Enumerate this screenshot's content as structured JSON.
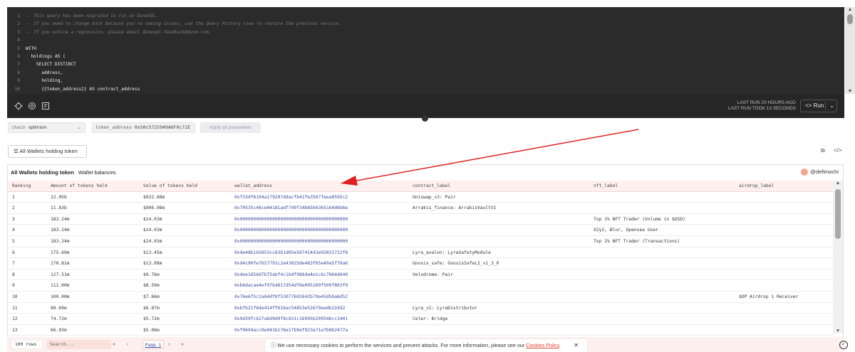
{
  "editor": {
    "lines": [
      {
        "n": "1",
        "text": "-- This query has been migrated to run on DuneSQL.",
        "comment": true
      },
      {
        "n": "2",
        "text": "-- If you need to change back because you're seeing issues, use the Query History view to restore the previous version.",
        "comment": true
      },
      {
        "n": "3",
        "text": "-- If you notice a regression, please email dunesql-feedback@dune.com.",
        "comment": true
      },
      {
        "n": "4",
        "text": "",
        "comment": false
      },
      {
        "n": "5",
        "text": "WITH",
        "comment": false
      },
      {
        "n": "6",
        "text": "  holdings AS (",
        "comment": false
      },
      {
        "n": "7",
        "text": "    SELECT DISTINCT",
        "comment": false
      },
      {
        "n": "8",
        "text": "      address,",
        "comment": false
      },
      {
        "n": "9",
        "text": "      holding,",
        "comment": false
      },
      {
        "n": "10",
        "text": "      {{token_address}} AS contract_address",
        "comment": false
      }
    ]
  },
  "toolbar": {
    "last_run": "LAST RUN 20 HOURS AGO",
    "last_run_took": "LAST RUN TOOK 13 SECONDS",
    "run_label": "Run"
  },
  "params": {
    "chain_label": "chain",
    "chain_value": "optimism",
    "token_label": "token_address",
    "token_value": "0x50c5725949A6F0c72E",
    "apply_label": "Apply all parameters"
  },
  "viz_tab": {
    "label": "All Wallets holding token"
  },
  "results": {
    "title": "All Wallets holding token",
    "subtitle": "Wallet balances",
    "author": "@defimochi",
    "columns": [
      "Ranking",
      "Amount of tokens held",
      "Value of tokens held",
      "wallet_address",
      "contract_label",
      "nft_label",
      "airdrop_label"
    ],
    "rows": [
      [
        "1",
        "12.05b",
        "$922.68m",
        "0xf334f6104a179207ddacfb41fe3567feea8595c2",
        "Uniswap_v3: Pair",
        "",
        ""
      ],
      [
        "2",
        "11.83b",
        "$906.08m",
        "0x70535c46ce04181adf749f34b65b6365164d6b6e",
        "Arrakis_finance: ArrakisVaultV1",
        "",
        ""
      ],
      [
        "3",
        "183.24m",
        "$14.03m",
        "0x0000000000000000000000000000000000000000",
        "",
        "Top 1% NFT Trader (Volume in $USD)",
        ""
      ],
      [
        "4",
        "183.24m",
        "$14.03m",
        "0x0000000000000000000000000000000000000000",
        "",
        "X2y2, Blur, Opensea User",
        ""
      ],
      [
        "5",
        "183.24m",
        "$14.03m",
        "0x0000000000000000000000000000000000000000",
        "",
        "Top 1% NFT Trader (Transactions)",
        ""
      ],
      [
        "6",
        "175.69m",
        "$13.45m",
        "0xde48b1b5853cc63b1d05e507414d3e02831722f8",
        "Lyra_avalon: LyraSafetyModule",
        "",
        ""
      ],
      [
        "7",
        "170.81m",
        "$13.08m",
        "0xd4c00fe7657791c2e43025de483f05e49a5f76a6",
        "Gnosis_safe: GnosisSafeL2_v1_3_0",
        "",
        ""
      ],
      [
        "8",
        "127.51m",
        "$9.76m",
        "0xdee1856d7b75abf4c1bdf986da4e1c6c7864d640",
        "Velodrome: Pair",
        "",
        ""
      ],
      [
        "9",
        "111.00m",
        "$8.50m",
        "0xb6dacae4ef97b4817d54df8e005269f509f803f9",
        "",
        "",
        ""
      ],
      [
        "10",
        "100.00m",
        "$7.66m",
        "0x76e6f5c2a64df0f53077602642b79a45d5ba6d52",
        "",
        "",
        "$OP Airdrop 1 Receiver"
      ],
      [
        "11",
        "89.69m",
        "$6.87m",
        "0xbfb21f64e414ff616ac54853e52679eedb22dd2",
        "Lyra_v1: LyraDistributor",
        "",
        ""
      ],
      [
        "12",
        "74.72m",
        "$5.72m",
        "0x9d39fc627a6d9d9f8c831c16995b209548cc3401",
        "Celer: Bridge",
        "",
        ""
      ],
      [
        "13",
        "66.03m",
        "$5.06m",
        "0xf0694acc9e941b176e17b9ef923e71e7b8b2477a",
        "",
        "",
        ""
      ]
    ]
  },
  "footer": {
    "rows_label": "100 rows",
    "search_placeholder": "Search...",
    "first_glyph": "«",
    "prev_glyph": "‹",
    "page_label": "Page 1",
    "next_glyph": "›",
    "last_glyph": "»"
  },
  "cookie": {
    "text": "We use necessary cookies to perform the services and prevent attacks. For more information, please see our",
    "link": "Cookies Policy",
    "period": "."
  },
  "colors": {
    "editor_bg": "#2b2b2b",
    "header_row_bg": "#fdf0ef",
    "address_blue": "#3b4a9c",
    "arrow_red": "#e02020"
  }
}
